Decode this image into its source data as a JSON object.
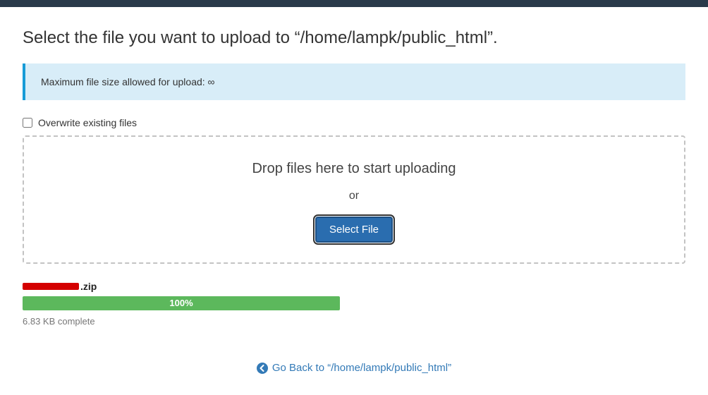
{
  "header": {
    "title_prefix": "Select the file you want to upload to ",
    "upload_path": "“/home/lampk/public_html”."
  },
  "info": {
    "max_size_label": "Maximum file size allowed for upload: ",
    "max_size_value": "∞"
  },
  "overwrite": {
    "label": "Overwrite existing files",
    "checked": false
  },
  "dropzone": {
    "title": "Drop files here to start uploading",
    "or": "or",
    "button": "Select File"
  },
  "upload": {
    "filename_suffix": ".zip",
    "progress_percent": "100%",
    "complete_text": "6.83 KB complete"
  },
  "footer": {
    "go_back_prefix": "Go Back to ",
    "go_back_path": "“/home/lampk/public_html”"
  }
}
